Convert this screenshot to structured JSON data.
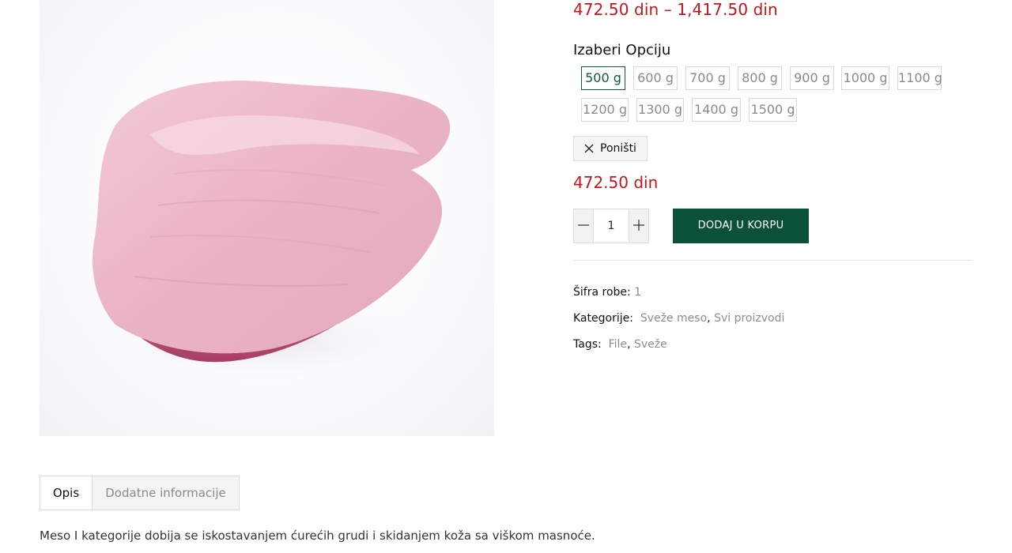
{
  "product": {
    "price_range": "472.50 din – 1,417.50 din",
    "options_label": "Izaberi Opciju",
    "options": [
      {
        "label": "500 g",
        "selected": true
      },
      {
        "label": "600 g",
        "selected": false
      },
      {
        "label": "700 g",
        "selected": false
      },
      {
        "label": "800 g",
        "selected": false
      },
      {
        "label": "900 g",
        "selected": false
      },
      {
        "label": "1000 g",
        "selected": false
      },
      {
        "label": "1100 g",
        "selected": false
      },
      {
        "label": "1200 g",
        "selected": false
      },
      {
        "label": "1300 g",
        "selected": false
      },
      {
        "label": "1400 g",
        "selected": false
      },
      {
        "label": "1500 g",
        "selected": false
      }
    ],
    "reset_label": "Poništi",
    "current_price": "472.50 din",
    "quantity": "1",
    "add_to_cart_label": "DODAJ U KORPU"
  },
  "meta": {
    "sku_label": "Šifra robe:",
    "sku_value": "1",
    "categories_label": "Kategorije:",
    "categories": [
      "Sveže meso",
      "Svi proizvodi"
    ],
    "tags_label": "Tags:",
    "tags": [
      "File",
      "Sveže"
    ]
  },
  "tabs": [
    {
      "label": "Opis",
      "active": true
    },
    {
      "label": "Dodatne informacije",
      "active": false
    }
  ],
  "description": "Meso I kategorije dobija se iskostavanjem ćurećih grudi i skidanjem koža sa viškom masnoće.",
  "colors": {
    "price": "#c4161c",
    "accent_green": "#0b5138",
    "muted_text": "#8d8d8d"
  },
  "icons": {
    "reset": "close-icon",
    "minus": "minus-icon",
    "plus": "plus-icon"
  }
}
